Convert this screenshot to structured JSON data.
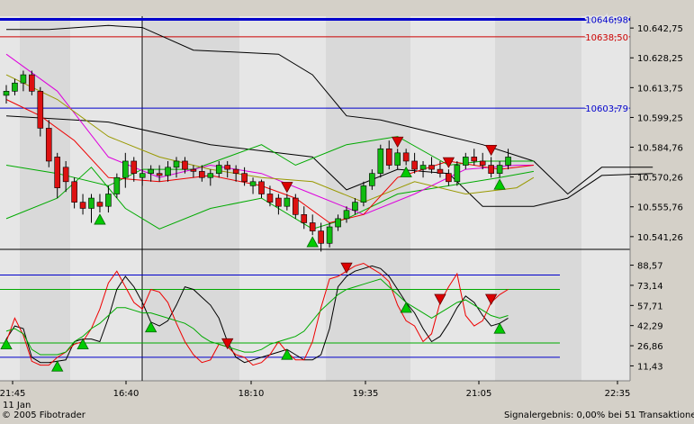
{
  "app": {
    "copyright": "© 2005 Fibotrader",
    "signal_result": "Signalergebnis: 0,00% bei 51 Transaktionen"
  },
  "chart_data": [
    {
      "type": "candlestick",
      "title": "",
      "y_ticks": [
        "10.642,75",
        "10.628,25",
        "10.613,75",
        "10.599,25",
        "10.584,76",
        "10.570,26",
        "10.555,76",
        "10.541,26"
      ],
      "y_tick_values": [
        10642.75,
        10628.25,
        10613.75,
        10599.25,
        10584.76,
        10570.26,
        10555.76,
        10541.26
      ],
      "ylim": [
        10535.5,
        10648.5
      ],
      "price_labels": [
        {
          "text": "10646,98",
          "value": 10646.98,
          "color": "#0000cc"
        },
        {
          "text": "10638,50",
          "value": 10638.5,
          "color": "#cc0000"
        },
        {
          "text": "10603,79",
          "value": 10603.79,
          "color": "#0000cc"
        }
      ],
      "candles": [
        [
          10610,
          10615,
          10606,
          10612
        ],
        [
          10612,
          10618,
          10610,
          10616
        ],
        [
          10616,
          10622,
          10612,
          10620
        ],
        [
          10620,
          10622,
          10610,
          10612
        ],
        [
          10612,
          10614,
          10590,
          10594
        ],
        [
          10594,
          10598,
          10575,
          10578
        ],
        [
          10580,
          10582,
          10560,
          10565
        ],
        [
          10575,
          10578,
          10563,
          10568
        ],
        [
          10568,
          10570,
          10555,
          10558
        ],
        [
          10558,
          10562,
          10552,
          10555
        ],
        [
          10555,
          10562,
          10548,
          10560
        ],
        [
          10558,
          10562,
          10553,
          10556
        ],
        [
          10556,
          10566,
          10553,
          10562
        ],
        [
          10562,
          10572,
          10560,
          10570
        ],
        [
          10570,
          10582,
          10565,
          10578
        ],
        [
          10578,
          10580,
          10568,
          10572
        ],
        [
          10570,
          10574,
          10566,
          10572
        ],
        [
          10572,
          10576,
          10568,
          10574
        ],
        [
          10572,
          10576,
          10568,
          10571
        ],
        [
          10571,
          10578,
          10568,
          10575
        ],
        [
          10575,
          10580,
          10570,
          10578
        ],
        [
          10578,
          10580,
          10572,
          10574
        ],
        [
          10574,
          10576,
          10570,
          10573
        ],
        [
          10573,
          10576,
          10568,
          10570
        ],
        [
          10570,
          10574,
          10566,
          10572
        ],
        [
          10572,
          10578,
          10570,
          10576
        ],
        [
          10576,
          10578,
          10570,
          10574
        ],
        [
          10574,
          10576,
          10568,
          10572
        ],
        [
          10572,
          10575,
          10566,
          10568
        ],
        [
          10566,
          10570,
          10562,
          10568
        ],
        [
          10568,
          10569,
          10560,
          10562
        ],
        [
          10562,
          10566,
          10556,
          10558
        ],
        [
          10560,
          10562,
          10552,
          10556
        ],
        [
          10556,
          10562,
          10554,
          10560
        ],
        [
          10560,
          10562,
          10550,
          10552
        ],
        [
          10552,
          10556,
          10545,
          10548
        ],
        [
          10548,
          10552,
          10542,
          10544
        ],
        [
          10544,
          10548,
          10534,
          10538
        ],
        [
          10538,
          10548,
          10536,
          10546
        ],
        [
          10546,
          10552,
          10544,
          10550
        ],
        [
          10550,
          10556,
          10548,
          10554
        ],
        [
          10554,
          10560,
          10552,
          10558
        ],
        [
          10558,
          10568,
          10556,
          10566
        ],
        [
          10566,
          10574,
          10564,
          10572
        ],
        [
          10572,
          10586,
          10570,
          10584
        ],
        [
          10584,
          10588,
          10574,
          10576
        ],
        [
          10576,
          10584,
          10574,
          10582
        ],
        [
          10582,
          10584,
          10576,
          10578
        ],
        [
          10578,
          10582,
          10572,
          10574
        ],
        [
          10574,
          10578,
          10570,
          10576
        ],
        [
          10576,
          10580,
          10572,
          10574
        ],
        [
          10574,
          10578,
          10570,
          10572
        ],
        [
          10572,
          10574,
          10566,
          10568
        ],
        [
          10568,
          10578,
          10566,
          10576
        ],
        [
          10576,
          10582,
          10574,
          10580
        ],
        [
          10580,
          10584,
          10576,
          10578
        ],
        [
          10578,
          10582,
          10574,
          10576
        ],
        [
          10576,
          10580,
          10570,
          10572
        ],
        [
          10572,
          10578,
          10570,
          10576
        ],
        [
          10576,
          10584,
          10574,
          10580
        ]
      ],
      "series_lines": [
        {
          "color": "#000000",
          "points": [
            [
              0,
              10642
            ],
            [
              5,
              10642
            ],
            [
              12,
              10644
            ],
            [
              16,
              10643
            ],
            [
              22,
              10632
            ],
            [
              32,
              10630
            ],
            [
              36,
              10620
            ],
            [
              40,
              10600
            ],
            [
              44,
              10598
            ],
            [
              50,
              10592
            ],
            [
              56,
              10586
            ],
            [
              62,
              10578
            ],
            [
              66,
              10562
            ],
            [
              70,
              10575
            ],
            [
              76,
              10575
            ]
          ]
        },
        {
          "color": "#000000",
          "points": [
            [
              0,
              10600
            ],
            [
              8,
              10598
            ],
            [
              12,
              10597
            ],
            [
              24,
              10586
            ],
            [
              36,
              10580
            ],
            [
              40,
              10564
            ],
            [
              46,
              10574
            ],
            [
              52,
              10572
            ],
            [
              56,
              10556
            ],
            [
              62,
              10556
            ],
            [
              66,
              10560
            ],
            [
              70,
              10571
            ],
            [
              76,
              10572
            ]
          ]
        },
        {
          "color": "#00aa00",
          "points": [
            [
              0,
              10576
            ],
            [
              6,
              10572
            ],
            [
              12,
              10566
            ],
            [
              16,
              10574
            ],
            [
              22,
              10574
            ],
            [
              30,
              10586
            ],
            [
              34,
              10576
            ],
            [
              40,
              10586
            ],
            [
              46,
              10590
            ],
            [
              52,
              10576
            ],
            [
              56,
              10578
            ],
            [
              62,
              10578
            ]
          ]
        },
        {
          "color": "#00aa00",
          "points": [
            [
              0,
              10550
            ],
            [
              6,
              10560
            ],
            [
              10,
              10575
            ],
            [
              14,
              10555
            ],
            [
              18,
              10545
            ],
            [
              24,
              10555
            ],
            [
              30,
              10560
            ],
            [
              36,
              10545
            ],
            [
              40,
              10550
            ],
            [
              46,
              10562
            ],
            [
              52,
              10566
            ],
            [
              58,
              10570
            ],
            [
              62,
              10573
            ]
          ]
        },
        {
          "color": "#dd00dd",
          "points": [
            [
              0,
              10630
            ],
            [
              6,
              10612
            ],
            [
              12,
              10580
            ],
            [
              18,
              10570
            ],
            [
              24,
              10576
            ],
            [
              30,
              10572
            ],
            [
              36,
              10562
            ],
            [
              42,
              10552
            ],
            [
              48,
              10562
            ],
            [
              54,
              10574
            ],
            [
              60,
              10576
            ],
            [
              62,
              10576
            ]
          ]
        },
        {
          "color": "#999900",
          "points": [
            [
              0,
              10620
            ],
            [
              6,
              10608
            ],
            [
              12,
              10590
            ],
            [
              18,
              10580
            ],
            [
              24,
              10574
            ],
            [
              30,
              10570
            ],
            [
              36,
              10568
            ],
            [
              42,
              10558
            ],
            [
              48,
              10568
            ],
            [
              54,
              10562
            ],
            [
              60,
              10565
            ],
            [
              62,
              10570
            ]
          ]
        },
        {
          "color": "#ee0000",
          "points": [
            [
              0,
              10608
            ],
            [
              4,
              10600
            ],
            [
              8,
              10588
            ],
            [
              12,
              10570
            ],
            [
              18,
              10568
            ],
            [
              24,
              10571
            ],
            [
              30,
              10566
            ],
            [
              34,
              10560
            ],
            [
              38,
              10548
            ],
            [
              42,
              10552
            ],
            [
              46,
              10570
            ],
            [
              52,
              10578
            ],
            [
              58,
              10574
            ],
            [
              62,
              10576
            ]
          ]
        }
      ],
      "buy_signals": [
        11,
        36,
        47,
        58
      ],
      "sell_signals": [
        33,
        46,
        52,
        57
      ]
    },
    {
      "type": "line",
      "title": "",
      "y_ticks": [
        "88,57",
        "73,14",
        "57,71",
        "42,29",
        "26,86",
        "11,43"
      ],
      "y_tick_values": [
        88.57,
        73.14,
        57.71,
        42.29,
        26.86,
        11.43
      ],
      "ylim": [
        0,
        100
      ],
      "h_lines": [
        {
          "value": 81,
          "color": "#0000cc"
        },
        {
          "value": 70,
          "color": "#00aa00"
        },
        {
          "value": 29,
          "color": "#00aa00"
        },
        {
          "value": 18,
          "color": "#0000cc"
        }
      ],
      "x_ticks": [
        "21:45",
        "16:40",
        "18:10",
        "19:35",
        "21:05",
        "22:35"
      ],
      "x_tick_bars": [
        0,
        16,
        29,
        42,
        55,
        68
      ],
      "date_label": "11 Jan",
      "series": [
        {
          "color": "#000000",
          "values": [
            32,
            42,
            40,
            18,
            14,
            14,
            15,
            16,
            30,
            32,
            32,
            30,
            48,
            70,
            80,
            72,
            60,
            45,
            42,
            46,
            58,
            72,
            70,
            64,
            58,
            48,
            30,
            18,
            14,
            16,
            18,
            20,
            22,
            24,
            20,
            16,
            16,
            20,
            40,
            72,
            80,
            84,
            86,
            88,
            86,
            80,
            70,
            60,
            52,
            40,
            30,
            34,
            44,
            56,
            65,
            60,
            50,
            42,
            44,
            48
          ]
        },
        {
          "color": "#ee0000",
          "values": [
            30,
            48,
            35,
            15,
            12,
            12,
            18,
            22,
            28,
            30,
            40,
            55,
            75,
            84,
            72,
            60,
            55,
            70,
            68,
            60,
            44,
            30,
            20,
            14,
            16,
            28,
            26,
            20,
            18,
            12,
            14,
            20,
            30,
            22,
            16,
            16,
            30,
            56,
            78,
            80,
            84,
            88,
            90,
            86,
            82,
            76,
            58,
            46,
            42,
            30,
            36,
            60,
            72,
            82,
            50,
            42,
            46,
            60,
            66,
            70
          ]
        },
        {
          "color": "#00aa00",
          "values": [
            38,
            40,
            36,
            24,
            20,
            20,
            20,
            22,
            30,
            34,
            40,
            44,
            50,
            56,
            56,
            54,
            52,
            52,
            50,
            48,
            46,
            44,
            40,
            34,
            30,
            28,
            26,
            24,
            22,
            22,
            24,
            28,
            30,
            32,
            34,
            38,
            46,
            54,
            60,
            66,
            70,
            72,
            74,
            76,
            78,
            72,
            66,
            60,
            56,
            52,
            48,
            52,
            56,
            60,
            62,
            58,
            54,
            50,
            48,
            50
          ]
        }
      ],
      "buy_signals": [
        0,
        6,
        9,
        17,
        33,
        47,
        58
      ],
      "sell_signals": [
        26,
        40,
        51,
        57
      ]
    }
  ]
}
